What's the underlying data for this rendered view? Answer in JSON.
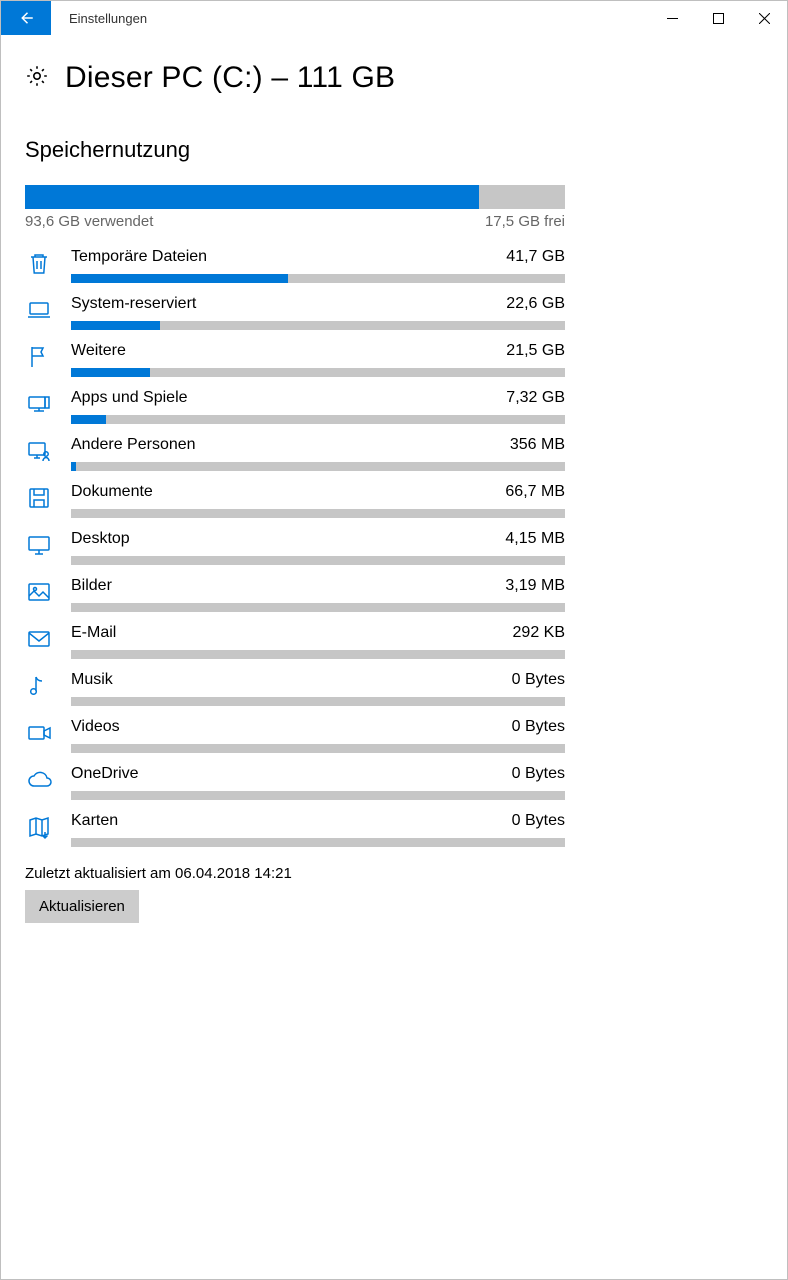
{
  "window": {
    "title": "Einstellungen"
  },
  "page": {
    "heading": "Dieser PC (C:) – 111 GB",
    "section": "Speichernutzung"
  },
  "usage": {
    "used_label": "93,6 GB verwendet",
    "free_label": "17,5 GB frei",
    "used_pct": 84
  },
  "categories": [
    {
      "icon": "trash",
      "label": "Temporäre Dateien",
      "size": "41,7 GB",
      "pct": 44
    },
    {
      "icon": "laptop",
      "label": "System-reserviert",
      "size": "22,6 GB",
      "pct": 18
    },
    {
      "icon": "flag",
      "label": "Weitere",
      "size": "21,5 GB",
      "pct": 16
    },
    {
      "icon": "apps",
      "label": "Apps und Spiele",
      "size": "7,32 GB",
      "pct": 7
    },
    {
      "icon": "people",
      "label": "Andere Personen",
      "size": "356 MB",
      "pct": 1
    },
    {
      "icon": "save",
      "label": "Dokumente",
      "size": "66,7 MB",
      "pct": 0
    },
    {
      "icon": "monitor",
      "label": "Desktop",
      "size": "4,15 MB",
      "pct": 0
    },
    {
      "icon": "image",
      "label": "Bilder",
      "size": "3,19 MB",
      "pct": 0
    },
    {
      "icon": "mail",
      "label": "E-Mail",
      "size": "292 KB",
      "pct": 0
    },
    {
      "icon": "music",
      "label": "Musik",
      "size": "0 Bytes",
      "pct": 0
    },
    {
      "icon": "video",
      "label": "Videos",
      "size": "0 Bytes",
      "pct": 0
    },
    {
      "icon": "cloud",
      "label": "OneDrive",
      "size": "0 Bytes",
      "pct": 0
    },
    {
      "icon": "map",
      "label": "Karten",
      "size": "0 Bytes",
      "pct": 0
    }
  ],
  "footer": {
    "updated": "Zuletzt aktualisiert am 06.04.2018 14:21",
    "refresh": "Aktualisieren"
  }
}
